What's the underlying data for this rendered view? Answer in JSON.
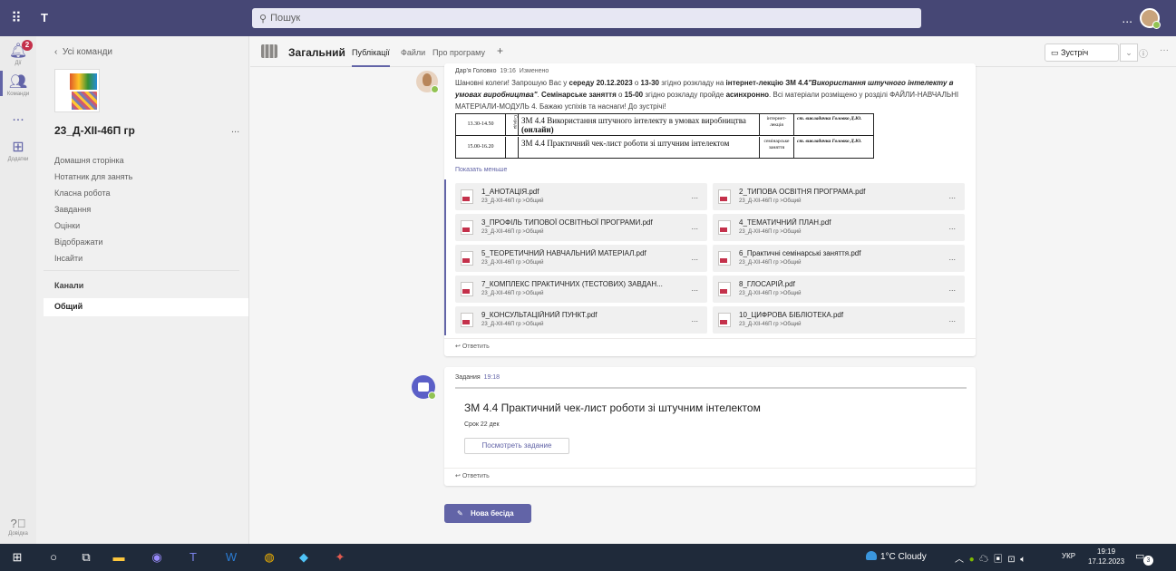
{
  "topbar": {
    "apps_icon": "waffle-grid-icon",
    "search_placeholder": "Пошук",
    "more_label": "...",
    "status_color": "#92c353"
  },
  "rail": {
    "activity_label": "Дії",
    "activity_badge": "2",
    "teams_label": "Команди",
    "more_label": "...",
    "apps_label": "Додатки",
    "help_label": "Довідка"
  },
  "team_panel": {
    "back_label": "Усі команди",
    "team_name": "23_Д-ХІІ-46П гр",
    "team_more": "...",
    "nav": [
      "Домашня сторінка",
      "Нотатник для занять",
      "Класна робота",
      "Завдання",
      "Оцінки",
      "Відображати",
      "Інсайти"
    ],
    "channels_heading": "Канали",
    "selected_channel": "Общий"
  },
  "channel_header": {
    "title": "Загальний",
    "tabs": [
      "Публікації",
      "Файли",
      "Про програму"
    ],
    "add_tab": "+",
    "meet_label": "Зустріч",
    "meet_chevron": "⌄",
    "info_icon": "ⓘ",
    "more": "···"
  },
  "post1": {
    "author": "Дар'я Головко",
    "time": "19:16",
    "edited": "Изменено",
    "text_a": "Шановні колеги! Запрошую Вас у ",
    "text_b": "середу 20.12.2023",
    "text_c": " о ",
    "text_d": "13-30",
    "text_e": " згідно розкладу на ",
    "text_f": "інтернет-лекцію ЗМ 4.4",
    "text_g": "\"Використання штучного інтелекту в умовах виробництва\"",
    "text_h": ". ",
    "text_i": "Семінарське заняття",
    "text_j": " о ",
    "text_k": "15-00",
    "text_l": " згідно розкладу пройде ",
    "text_m": "асинхронно",
    "text_n": ". Всі матеріали розміщено у розділі ФАЙЛИ-НАВЧАЛЬНІ МАТЕРІАЛИ-МОДУЛЬ 4. Бажаю успіхів та наснаги! До зустрічі!",
    "schedule": {
      "day_label": "Середа",
      "rows": [
        {
          "time": "13.30-14.50",
          "topic": "ЗМ 4.4  Використання штучного інтелекту в умовах виробництва",
          "topic_bold": "(онлайн)",
          "type": "інтернет-лекція",
          "teacher": "ст. викладачка Головко Д.Ю."
        },
        {
          "time": "15.00-16.20",
          "topic": "ЗМ 4.4 Практичний чек-лист роботи зі штучним інтелектом",
          "topic_bold": "",
          "type": "семінарське заняття",
          "teacher": "ст. викладачка Головко Д.Ю."
        }
      ]
    },
    "show_less": "Показать меньше",
    "files": [
      {
        "name": "1_АНОТАЦІЯ.pdf",
        "path": "23_Д-ХІІ-46П гр >Общий"
      },
      {
        "name": "2_ТИПОВА ОСВІТНЯ ПРОГРАМА.pdf",
        "path": "23_Д-ХІІ-46П гр >Общий"
      },
      {
        "name": "3_ПРОФІЛЬ ТИПОВОЇ ОСВІТНЬОЇ ПРОГРАМИ.pdf",
        "path": "23_Д-ХІІ-46П гр >Общий"
      },
      {
        "name": "4_ТЕМАТИЧНИЙ ПЛАН.pdf",
        "path": "23_Д-ХІІ-46П гр >Общий"
      },
      {
        "name": "5_ТЕОРЕТИЧНИЙ НАВЧАЛЬНИЙ МАТЕРІАЛ.pdf",
        "path": "23_Д-ХІІ-46П гр >Общий"
      },
      {
        "name": "6_Практичні семінарські заняття.pdf",
        "path": "23_Д-ХІІ-46П гр >Общий"
      },
      {
        "name": "7_КОМПЛЕКС ПРАКТИЧНИХ (ТЕСТОВИХ) ЗАВДАН...",
        "path": "23_Д-ХІІ-46П гр >Общий"
      },
      {
        "name": "8_ГЛОСАРІЙ.pdf",
        "path": "23_Д-ХІІ-46П гр >Общий"
      },
      {
        "name": "9_КОНСУЛЬТАЦІЙНИЙ ПУНКТ.pdf",
        "path": "23_Д-ХІІ-46П гр >Общий"
      },
      {
        "name": "10_ЦИФРОВА БІБЛІОТЕКА.pdf",
        "path": "23_Д-ХІІ-46П гр >Общий"
      }
    ],
    "file_more": "...",
    "reply": "Ответить"
  },
  "post2": {
    "author": "Задания",
    "time": "19:18",
    "card_title": "ЗМ 4.4 Практичний чек-лист роботи зі штучним інтелектом",
    "due": "Срок 22 дек",
    "button": "Посмотреть задание",
    "reply": "Ответить"
  },
  "new_conversation": "Нова бесіда",
  "taskbar": {
    "weather": "1°C  Cloudy",
    "lang": "УКР",
    "time": "19:19",
    "date": "17.12.2023",
    "notifications": "3"
  },
  "accent_color": "#6264a7"
}
